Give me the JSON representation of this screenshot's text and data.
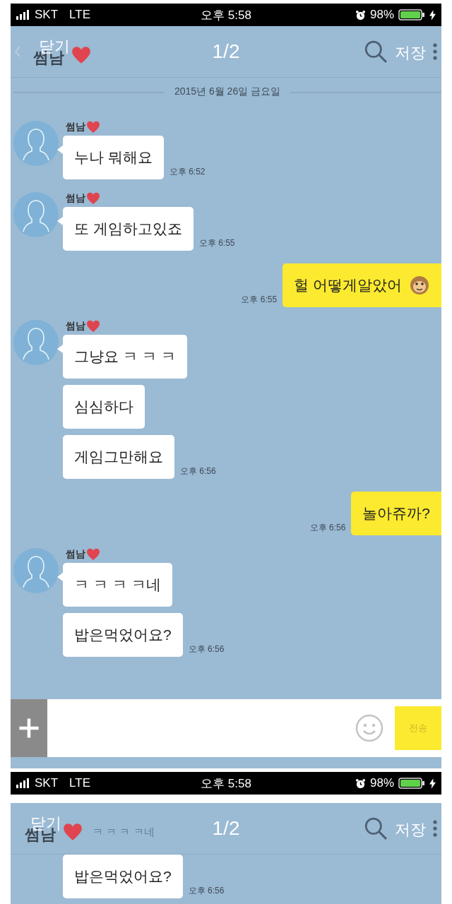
{
  "screens": [
    {
      "status_bar": {
        "carrier": "SKT",
        "network": "LTE",
        "time": "오후 5:58",
        "battery": "98%"
      },
      "header": {
        "close": "닫기",
        "title": "썸남",
        "page": "1/2",
        "save": "저장"
      },
      "date": "2015년 6월 26일 금요일",
      "groups": [
        {
          "kind": "received",
          "sender": "썸남",
          "bubbles": [
            {
              "text": "누나 뭐해요"
            }
          ],
          "time": "오후 6:52"
        },
        {
          "kind": "received",
          "sender": "썸남",
          "bubbles": [
            {
              "text": "또 게임하고있죠"
            }
          ],
          "time": "오후 6:55"
        },
        {
          "kind": "sent",
          "bubbles": [
            {
              "text": "헐 어떻게알았어",
              "sticker": true
            }
          ],
          "time": "오후 6:55"
        },
        {
          "kind": "received",
          "sender": "썸남",
          "bubbles": [
            {
              "text": "그냥요 ㅋ ㅋ ㅋ"
            },
            {
              "text": "심심하다"
            },
            {
              "text": "게임그만해요"
            }
          ],
          "time": "오후 6:56"
        },
        {
          "kind": "sent",
          "bubbles": [
            {
              "text": "놀아쥬까?"
            }
          ],
          "time": "오후 6:56"
        },
        {
          "kind": "received",
          "sender": "썸남",
          "bubbles": [
            {
              "text": "ㅋ ㅋ ㅋ ㅋ네"
            },
            {
              "text": "밥은먹었어요?"
            }
          ],
          "time": "오후 6:56"
        }
      ],
      "input": {
        "send": "전송"
      }
    },
    {
      "status_bar": {
        "carrier": "SKT",
        "network": "LTE",
        "time": "오후 5:58",
        "battery": "98%"
      },
      "header": {
        "close": "닫기",
        "title": "썸남",
        "page": "1/2",
        "save": "저장",
        "faded_text": "ㅋ ㅋ ㅋ ㅋ네"
      },
      "groups": [
        {
          "kind": "received",
          "bubbles": [
            {
              "text": "밥은먹었어요?"
            }
          ],
          "time": "오후 6:56"
        }
      ]
    }
  ]
}
